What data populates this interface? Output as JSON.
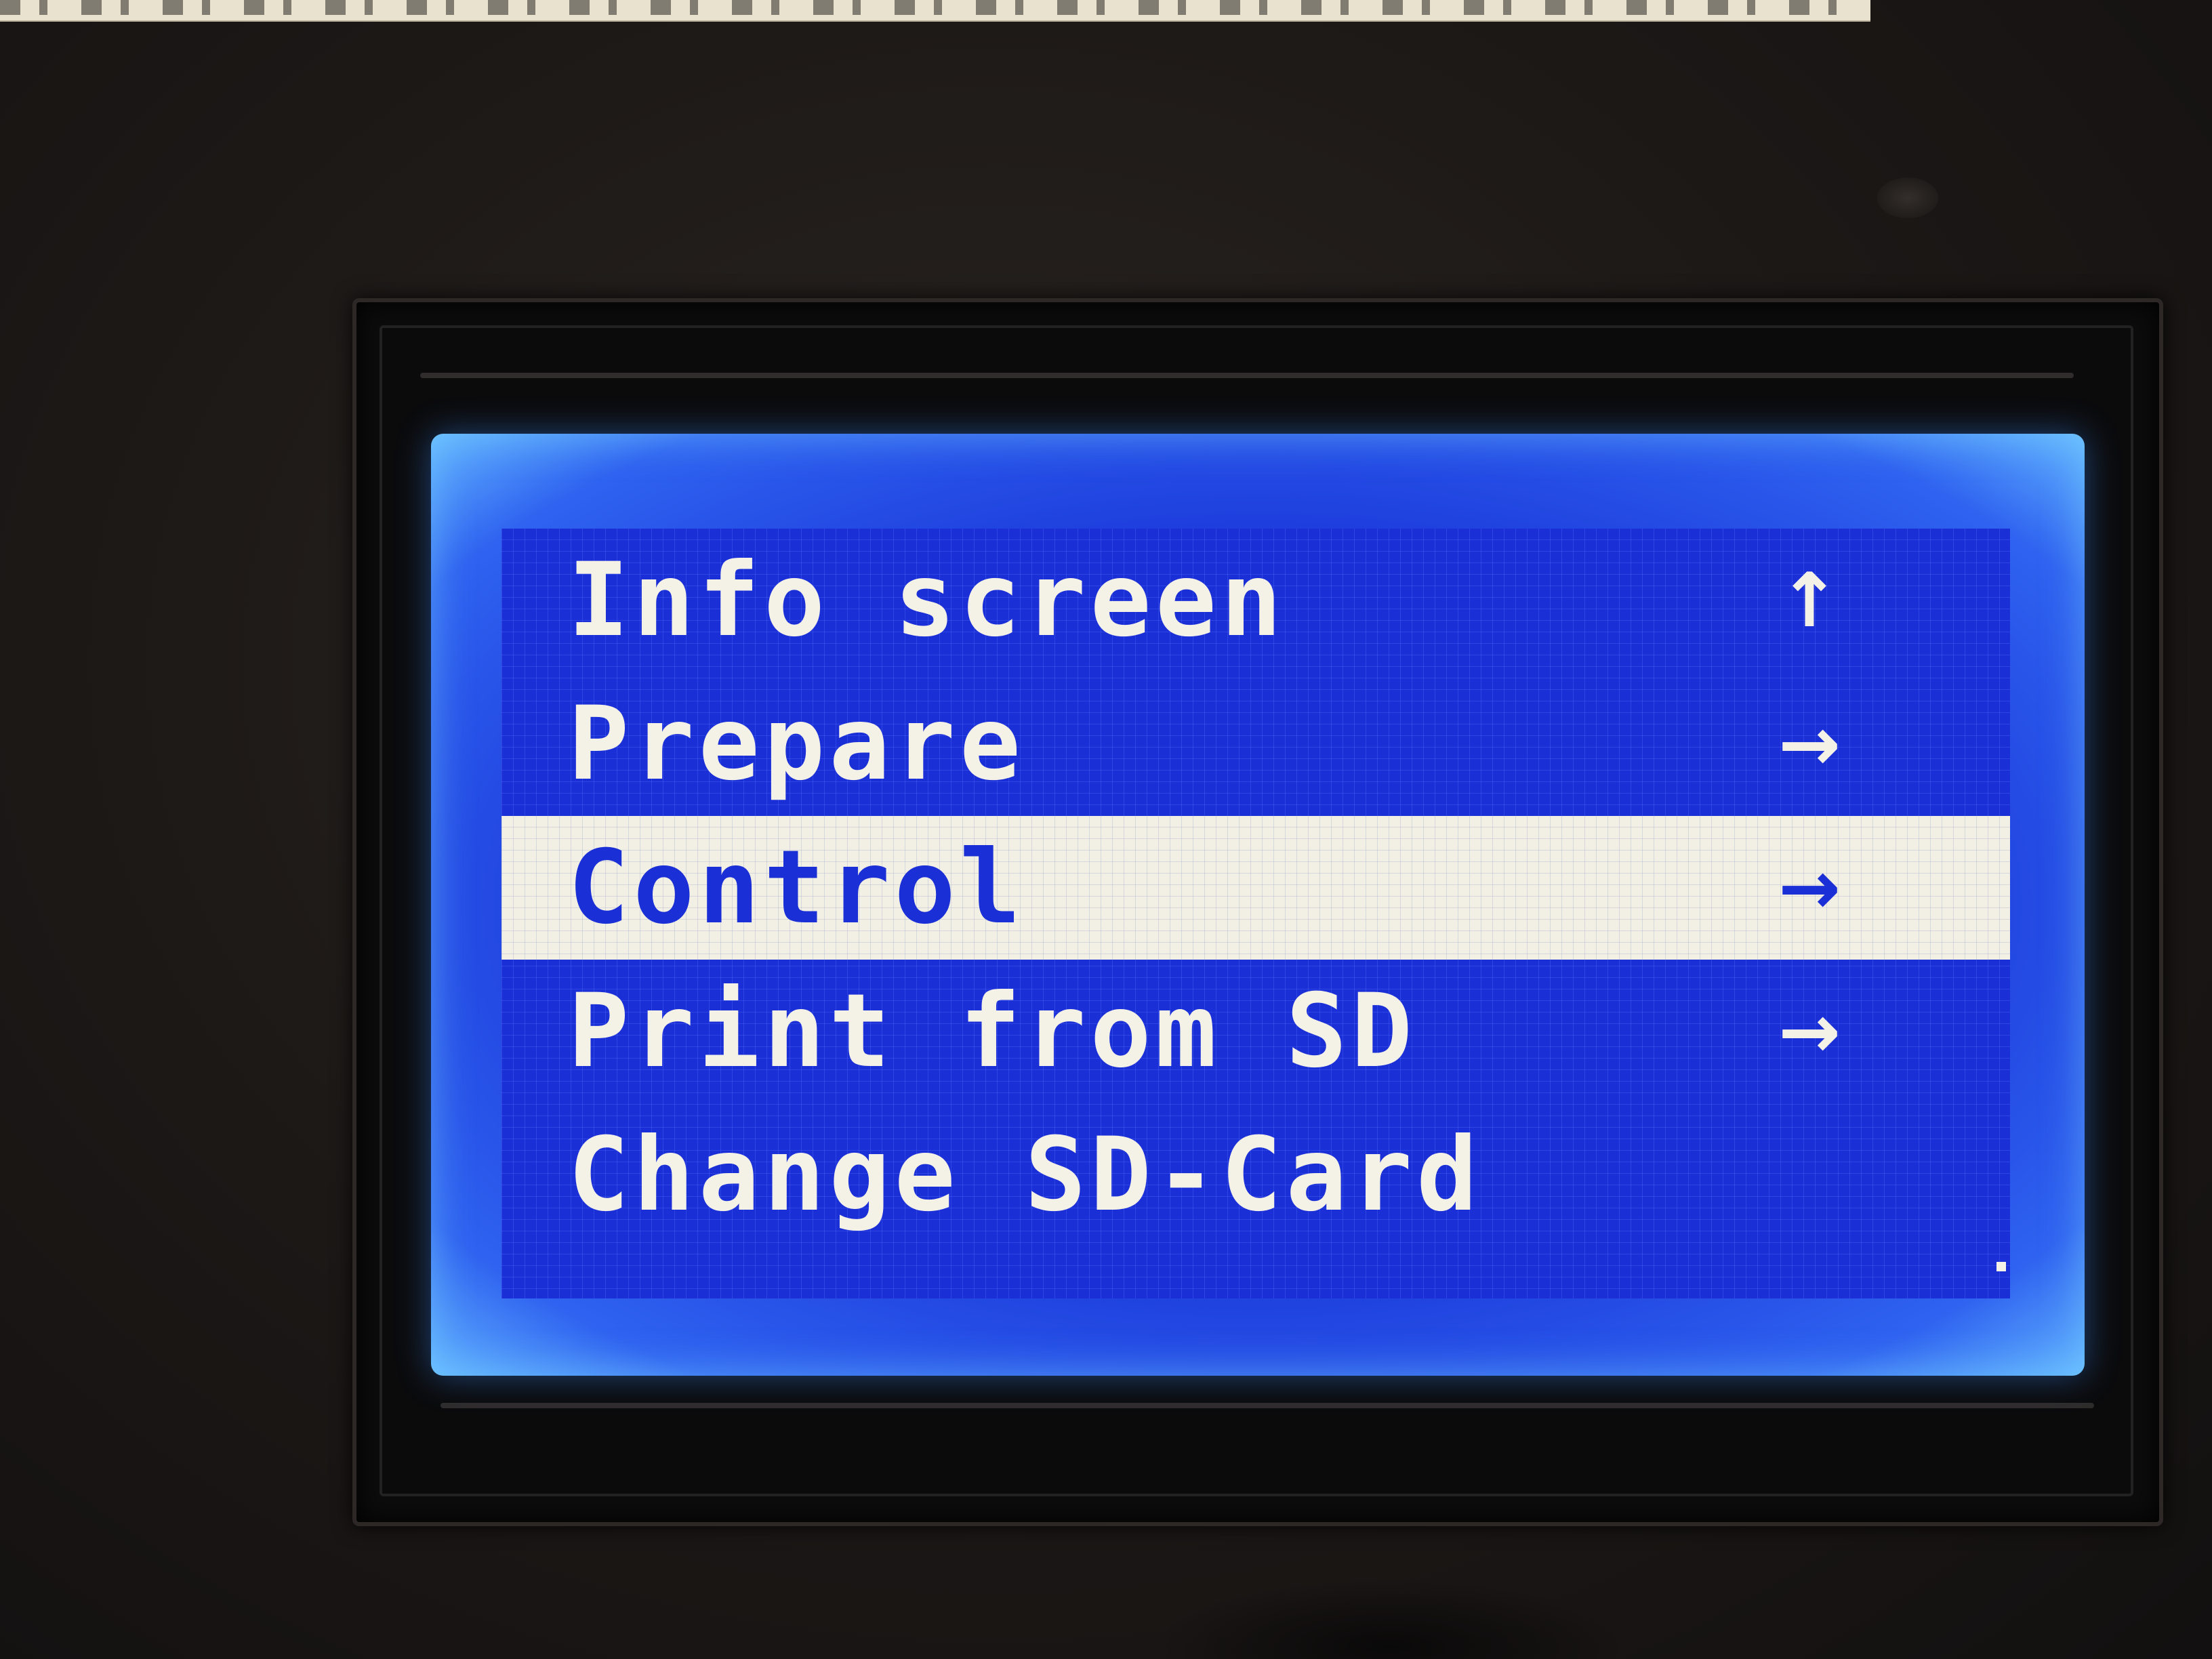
{
  "device": {
    "display_type": "LCD 128x64 graphical",
    "colors": {
      "backlight": "#1b2fd6",
      "text": "#f4f1e6",
      "highlight_bg": "#f2f0e4",
      "highlight_text": "#1b2fd6"
    }
  },
  "menu": {
    "items": [
      {
        "label": "Info screen",
        "arrow": "↑",
        "arrow_icon": "back-arrow-up-icon",
        "selected": false
      },
      {
        "label": "Prepare",
        "arrow": "→",
        "arrow_icon": "submenu-arrow-icon",
        "selected": false
      },
      {
        "label": "Control",
        "arrow": "→",
        "arrow_icon": "submenu-arrow-icon",
        "selected": true
      },
      {
        "label": "Print from SD",
        "arrow": "→",
        "arrow_icon": "submenu-arrow-icon",
        "selected": false
      },
      {
        "label": "Change SD-Card",
        "arrow": "",
        "arrow_icon": "",
        "selected": false
      }
    ]
  }
}
